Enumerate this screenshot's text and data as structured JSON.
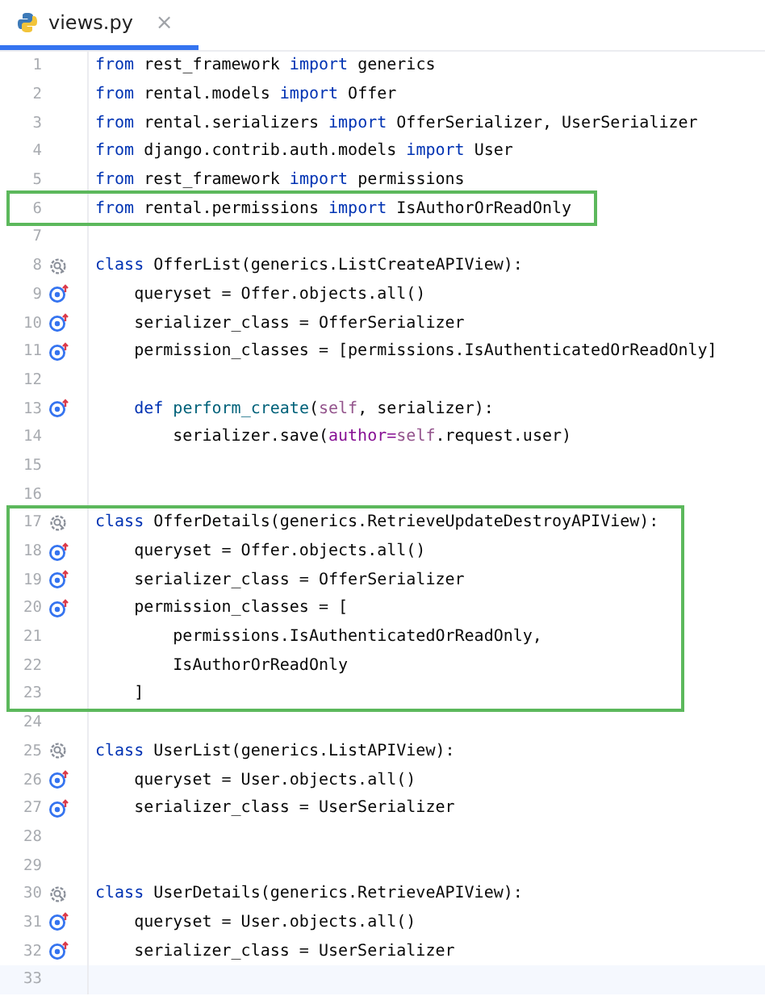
{
  "tabs": [
    {
      "label": "views.py",
      "close": "×",
      "selected": true
    }
  ],
  "blocks": [
    {
      "boxed": false,
      "lines": [
        {
          "number": "1",
          "tokens": [
            {
              "kind": "kw",
              "text": "from"
            },
            {
              "kind": "plain",
              "text": " rest_framework "
            },
            {
              "kind": "kw",
              "text": "import"
            },
            {
              "kind": "plain",
              "text": " generics"
            }
          ]
        },
        {
          "number": "2",
          "tokens": [
            {
              "kind": "kw",
              "text": "from"
            },
            {
              "kind": "plain",
              "text": " rental.models "
            },
            {
              "kind": "kw",
              "text": "import"
            },
            {
              "kind": "plain",
              "text": " Offer"
            }
          ]
        },
        {
          "number": "3",
          "tokens": [
            {
              "kind": "kw",
              "text": "from"
            },
            {
              "kind": "plain",
              "text": " rental.serializers "
            },
            {
              "kind": "kw",
              "text": "import"
            },
            {
              "kind": "plain",
              "text": " OfferSerializer, UserSerializer"
            }
          ]
        },
        {
          "number": "4",
          "tokens": [
            {
              "kind": "kw",
              "text": "from"
            },
            {
              "kind": "plain",
              "text": " django.contrib.auth.models "
            },
            {
              "kind": "kw",
              "text": "import"
            },
            {
              "kind": "plain",
              "text": " User"
            }
          ]
        },
        {
          "number": "5",
          "tokens": [
            {
              "kind": "kw",
              "text": "from"
            },
            {
              "kind": "plain",
              "text": " rest_framework "
            },
            {
              "kind": "kw",
              "text": "import"
            },
            {
              "kind": "plain",
              "text": " permissions"
            }
          ]
        }
      ]
    },
    {
      "boxed": true,
      "lines": [
        {
          "number": "6",
          "tokens": [
            {
              "kind": "kw",
              "text": "from"
            },
            {
              "kind": "plain",
              "text": " rental.permissions "
            },
            {
              "kind": "kw",
              "text": "import"
            },
            {
              "kind": "plain",
              "text": " IsAuthorOrReadOnly"
            }
          ]
        }
      ]
    },
    {
      "boxed": false,
      "lines": [
        {
          "number": "7"
        },
        {
          "number": "8",
          "kind": "class",
          "tokens": [
            {
              "kind": "kw",
              "text": "class"
            },
            {
              "kind": "plain",
              "text": " OfferList(generics.ListCreateAPIView):"
            }
          ]
        },
        {
          "number": "9",
          "kind": "override",
          "tokens": [
            {
              "kind": "plain",
              "text": "    queryset = Offer.objects.all()"
            }
          ]
        },
        {
          "number": "10",
          "kind": "override",
          "tokens": [
            {
              "kind": "plain",
              "text": "    serializer_class = OfferSerializer"
            }
          ]
        },
        {
          "number": "11",
          "kind": "override",
          "tokens": [
            {
              "kind": "plain",
              "text": "    permission_classes = [permissions.IsAuthenticatedOrReadOnly]"
            }
          ]
        },
        {
          "number": "12"
        },
        {
          "number": "13",
          "kind": "override",
          "tokens": [
            {
              "kind": "kw",
              "text": "    def "
            },
            {
              "kind": "fn",
              "text": "perform_create"
            },
            {
              "kind": "plain",
              "text": "("
            },
            {
              "kind": "self",
              "text": "self"
            },
            {
              "kind": "plain",
              "text": ", serializer):"
            }
          ]
        },
        {
          "number": "14",
          "tokens": [
            {
              "kind": "plain",
              "text": "        serializer.save("
            },
            {
              "kind": "param",
              "text": "author="
            },
            {
              "kind": "self",
              "text": "self"
            },
            {
              "kind": "plain",
              "text": ".request.user)"
            }
          ]
        },
        {
          "number": "15"
        },
        {
          "number": "16"
        }
      ]
    },
    {
      "boxed": true,
      "lines": [
        {
          "number": "17",
          "kind": "class",
          "tokens": [
            {
              "kind": "kw",
              "text": "class"
            },
            {
              "kind": "plain",
              "text": " OfferDetails(generics.RetrieveUpdateDestroyAPIView):"
            }
          ]
        },
        {
          "number": "18",
          "kind": "override",
          "tokens": [
            {
              "kind": "plain",
              "text": "    queryset = Offer.objects.all()"
            }
          ]
        },
        {
          "number": "19",
          "kind": "override",
          "tokens": [
            {
              "kind": "plain",
              "text": "    serializer_class = OfferSerializer"
            }
          ]
        },
        {
          "number": "20",
          "kind": "override",
          "tokens": [
            {
              "kind": "plain",
              "text": "    permission_classes = ["
            }
          ]
        },
        {
          "number": "21",
          "tokens": [
            {
              "kind": "plain",
              "text": "        permissions.IsAuthenticatedOrReadOnly,"
            }
          ]
        },
        {
          "number": "22",
          "tokens": [
            {
              "kind": "plain",
              "text": "        IsAuthorOrReadOnly"
            }
          ]
        },
        {
          "number": "23",
          "tokens": [
            {
              "kind": "plain",
              "text": "    ]"
            }
          ]
        }
      ]
    },
    {
      "boxed": false,
      "lines": [
        {
          "number": "24"
        },
        {
          "number": "25",
          "kind": "class",
          "tokens": [
            {
              "kind": "kw",
              "text": "class"
            },
            {
              "kind": "plain",
              "text": " UserList(generics.ListAPIView):"
            }
          ]
        },
        {
          "number": "26",
          "kind": "override",
          "tokens": [
            {
              "kind": "plain",
              "text": "    queryset = User.objects.all()"
            }
          ]
        },
        {
          "number": "27",
          "kind": "override",
          "tokens": [
            {
              "kind": "plain",
              "text": "    serializer_class = UserSerializer"
            }
          ]
        },
        {
          "number": "28"
        },
        {
          "number": "29"
        },
        {
          "number": "30",
          "kind": "class",
          "tokens": [
            {
              "kind": "kw",
              "text": "class"
            },
            {
              "kind": "plain",
              "text": " UserDetails(generics.RetrieveAPIView):"
            }
          ]
        },
        {
          "number": "31",
          "kind": "override",
          "tokens": [
            {
              "kind": "plain",
              "text": "    queryset = User.objects.all()"
            }
          ]
        },
        {
          "number": "32",
          "kind": "override",
          "tokens": [
            {
              "kind": "plain",
              "text": "    serializer_class = UserSerializer"
            }
          ]
        },
        {
          "number": "33",
          "current": true
        }
      ]
    }
  ]
}
